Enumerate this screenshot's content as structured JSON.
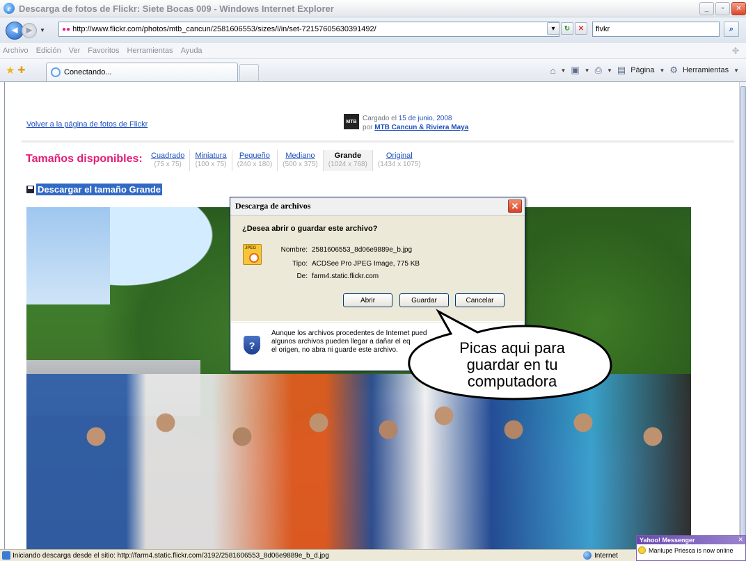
{
  "window": {
    "title": "Descarga de fotos de Flickr: Siete Bocas 009 - Windows Internet Explorer"
  },
  "address_bar": {
    "url": "http://www.flickr.com/photos/mtb_cancun/2581606553/sizes/l/in/set-72157605630391492/",
    "search_value": "flvkr"
  },
  "menu": {
    "items": [
      "Archivo",
      "Edición",
      "Ver",
      "Favoritos",
      "Herramientas",
      "Ayuda"
    ]
  },
  "tab": {
    "label": "Conectando..."
  },
  "command_bar": {
    "page_label": "Página",
    "tools_label": "Herramientas"
  },
  "page": {
    "back_link": "Volver a la página de fotos de Flickr",
    "uploaded_line1": "Cargado el",
    "uploaded_date": "15 de junio, 2008",
    "uploaded_by": "por",
    "uploader": "MTB Cancun & Riviera Maya",
    "sizes_title": "Tamaños disponibles:",
    "sizes": [
      {
        "name": "Cuadrado",
        "dims": "(75 x 75)",
        "active": false
      },
      {
        "name": "Miniatura",
        "dims": "(100 x 75)",
        "active": false
      },
      {
        "name": "Pequeño",
        "dims": "(240 x 180)",
        "active": false
      },
      {
        "name": "Mediano",
        "dims": "(500 x 375)",
        "active": false
      },
      {
        "name": "Grande",
        "dims": "(1024 x 768)",
        "active": true
      },
      {
        "name": "Original",
        "dims": "(1434 x 1075)",
        "active": false
      }
    ],
    "download_link": "Descargar el tamaño Grande"
  },
  "dialog": {
    "title": "Descarga de archivos",
    "question": "¿Desea abrir o guardar este archivo?",
    "name_label": "Nombre:",
    "name_value": "2581606553_8d06e9889e_b.jpg",
    "type_label": "Tipo:",
    "type_value": "ACDSee Pro JPEG Image, 775 KB",
    "from_label": "De:",
    "from_value": "farm4.static.flickr.com",
    "open_label": "Abrir",
    "save_label": "Guardar",
    "cancel_label": "Cancelar",
    "warning_line1": "Aunque los archivos procedentes de Internet pued",
    "warning_line2": "algunos archivos pueden llegar a dañar el eq",
    "warning_line3": "el origen, no abra ni guarde este archivo."
  },
  "callout": {
    "line1": "Picas aqui para",
    "line2": "guardar en tu",
    "line3": "computadora"
  },
  "status_bar": {
    "text": "Iniciando descarga desde el sitio: http://farm4.static.flickr.com/3192/2581606553_8d06e9889e_b_d.jpg",
    "zone": "Internet"
  },
  "yahoo": {
    "title": "Yahoo! Messenger",
    "message": "Marilupe Priesca is now online"
  }
}
